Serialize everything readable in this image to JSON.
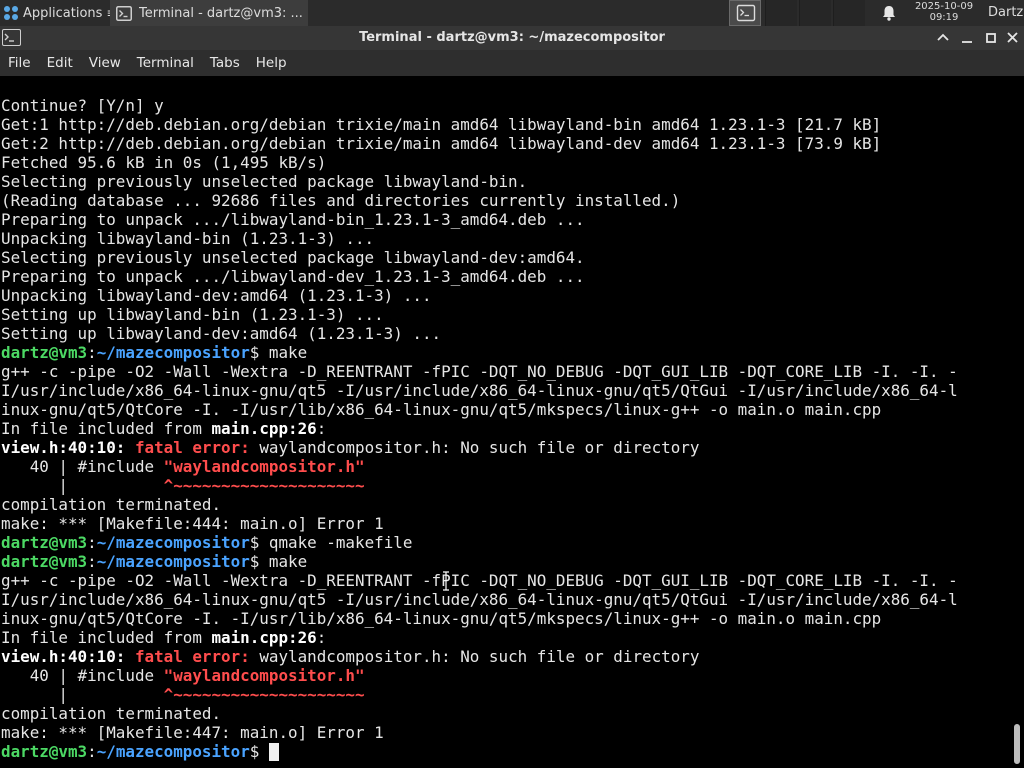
{
  "panel": {
    "apps_label": "Applications",
    "task_label": "Terminal - dartz@vm3: ...",
    "clock_date": "2025-10-09",
    "clock_time": "09:19",
    "user": "Dartz"
  },
  "window": {
    "title": "Terminal - dartz@vm3: ~/mazecompositor"
  },
  "menu": [
    "File",
    "Edit",
    "View",
    "Terminal",
    "Tabs",
    "Help"
  ],
  "colors": {
    "prompt_user": "#4cd964",
    "prompt_path": "#4aa3ff",
    "error": "#ff4d4d",
    "background": "#000000"
  },
  "terminal": {
    "lines": [
      [
        {
          "t": "Continue? [Y/n] y"
        }
      ],
      [
        {
          "t": "Get:1 http://deb.debian.org/debian trixie/main amd64 libwayland-bin amd64 1.23.1-3 [21.7 kB]"
        }
      ],
      [
        {
          "t": "Get:2 http://deb.debian.org/debian trixie/main amd64 libwayland-dev amd64 1.23.1-3 [73.9 kB]"
        }
      ],
      [
        {
          "t": "Fetched 95.6 kB in 0s (1,495 kB/s)"
        }
      ],
      [
        {
          "t": "Selecting previously unselected package libwayland-bin."
        }
      ],
      [
        {
          "t": "(Reading database ... 92686 files and directories currently installed.)"
        }
      ],
      [
        {
          "t": "Preparing to unpack .../libwayland-bin_1.23.1-3_amd64.deb ..."
        }
      ],
      [
        {
          "t": "Unpacking libwayland-bin (1.23.1-3) ..."
        }
      ],
      [
        {
          "t": "Selecting previously unselected package libwayland-dev:amd64."
        }
      ],
      [
        {
          "t": "Preparing to unpack .../libwayland-dev_1.23.1-3_amd64.deb ..."
        }
      ],
      [
        {
          "t": "Unpacking libwayland-dev:amd64 (1.23.1-3) ..."
        }
      ],
      [
        {
          "t": "Setting up libwayland-bin (1.23.1-3) ..."
        }
      ],
      [
        {
          "t": "Setting up libwayland-dev:amd64 (1.23.1-3) ..."
        }
      ],
      [
        {
          "t": "dartz@vm3",
          "c": "g"
        },
        {
          "t": ":"
        },
        {
          "t": "~/mazecompositor",
          "c": "b"
        },
        {
          "t": "$ make"
        }
      ],
      [
        {
          "t": "g++ -c -pipe -O2 -Wall -Wextra -D_REENTRANT -fPIC -DQT_NO_DEBUG -DQT_GUI_LIB -DQT_CORE_LIB -I. -I. -"
        }
      ],
      [
        {
          "t": "I/usr/include/x86_64-linux-gnu/qt5 -I/usr/include/x86_64-linux-gnu/qt5/QtGui -I/usr/include/x86_64-l"
        }
      ],
      [
        {
          "t": "inux-gnu/qt5/QtCore -I. -I/usr/lib/x86_64-linux-gnu/qt5/mkspecs/linux-g++ -o main.o main.cpp"
        }
      ],
      [
        {
          "t": "In file included from "
        },
        {
          "t": "main.cpp:26",
          "c": "w"
        },
        {
          "t": ":"
        }
      ],
      [
        {
          "t": "view.h:40:10: ",
          "c": "w"
        },
        {
          "t": "fatal error: ",
          "c": "r"
        },
        {
          "t": "waylandcompositor.h: No such file or directory"
        }
      ],
      [
        {
          "t": "   40 | #include "
        },
        {
          "t": "\"waylandcompositor.h\"",
          "c": "r"
        }
      ],
      [
        {
          "t": "      |          "
        },
        {
          "t": "^~~~~~~~~~~~~~~~~~~~~",
          "c": "r"
        }
      ],
      [
        {
          "t": "compilation terminated."
        }
      ],
      [
        {
          "t": "make: *** [Makefile:444: main.o] Error 1"
        }
      ],
      [
        {
          "t": "dartz@vm3",
          "c": "g"
        },
        {
          "t": ":"
        },
        {
          "t": "~/mazecompositor",
          "c": "b"
        },
        {
          "t": "$ qmake -makefile"
        }
      ],
      [
        {
          "t": "dartz@vm3",
          "c": "g"
        },
        {
          "t": ":"
        },
        {
          "t": "~/mazecompositor",
          "c": "b"
        },
        {
          "t": "$ make"
        }
      ],
      [
        {
          "t": "g++ -c -pipe -O2 -Wall -Wextra -D_REENTRANT -fPIC -DQT_NO_DEBUG -DQT_GUI_LIB -DQT_CORE_LIB -I. -I. -"
        }
      ],
      [
        {
          "t": "I/usr/include/x86_64-linux-gnu/qt5 -I/usr/include/x86_64-linux-gnu/qt5/QtGui -I/usr/include/x86_64-l"
        }
      ],
      [
        {
          "t": "inux-gnu/qt5/QtCore -I. -I/usr/lib/x86_64-linux-gnu/qt5/mkspecs/linux-g++ -o main.o main.cpp"
        }
      ],
      [
        {
          "t": "In file included from "
        },
        {
          "t": "main.cpp:26",
          "c": "w"
        },
        {
          "t": ":"
        }
      ],
      [
        {
          "t": "view.h:40:10: ",
          "c": "w"
        },
        {
          "t": "fatal error: ",
          "c": "r"
        },
        {
          "t": "waylandcompositor.h: No such file or directory"
        }
      ],
      [
        {
          "t": "   40 | #include "
        },
        {
          "t": "\"waylandcompositor.h\"",
          "c": "r"
        }
      ],
      [
        {
          "t": "      |          "
        },
        {
          "t": "^~~~~~~~~~~~~~~~~~~~~",
          "c": "r"
        }
      ],
      [
        {
          "t": "compilation terminated."
        }
      ],
      [
        {
          "t": "make: *** [Makefile:447: main.o] Error 1"
        }
      ],
      [
        {
          "t": "dartz@vm3",
          "c": "g"
        },
        {
          "t": ":"
        },
        {
          "t": "~/mazecompositor",
          "c": "b"
        },
        {
          "t": "$ "
        }
      ]
    ]
  }
}
